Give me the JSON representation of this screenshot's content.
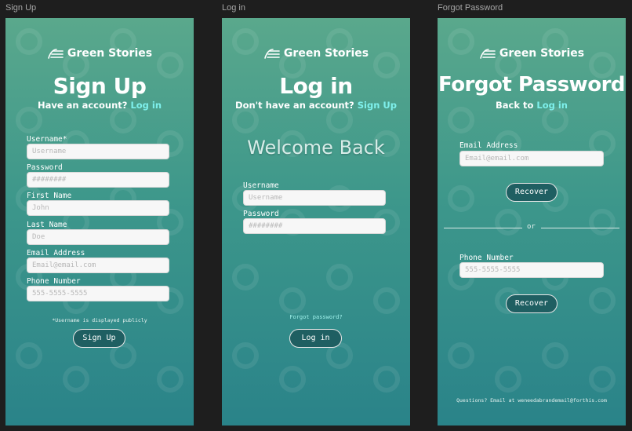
{
  "frames": {
    "signup": "Sign Up",
    "login": "Log in",
    "forgot": "Forgot Password"
  },
  "brand": {
    "name": "Green Stories"
  },
  "signup": {
    "title": "Sign Up",
    "subtitle_prefix": "Have an account?",
    "subtitle_link": "Log in",
    "fields": [
      {
        "label": "Username*",
        "placeholder": "Username"
      },
      {
        "label": "Password",
        "placeholder": "########"
      },
      {
        "label": "First Name",
        "placeholder": "John"
      },
      {
        "label": "Last Name",
        "placeholder": "Doe"
      },
      {
        "label": "Email Address",
        "placeholder": "Email@email.com"
      },
      {
        "label": "Phone Number",
        "placeholder": "555-5555-5555"
      }
    ],
    "note": "*Username is displayed publicly",
    "button": "Sign Up"
  },
  "login": {
    "title": "Log in",
    "subtitle_prefix": "Don't have an account?",
    "subtitle_link": "Sign Up",
    "welcome": "Welcome Back",
    "fields": [
      {
        "label": "Username",
        "placeholder": "Username"
      },
      {
        "label": "Password",
        "placeholder": "########"
      }
    ],
    "forgot_link": "Forgot password?",
    "button": "Log in"
  },
  "forgot": {
    "title": "Forgot Password",
    "subtitle_prefix": "Back to",
    "subtitle_link": "Log in",
    "email_label": "Email Address",
    "email_placeholder": "Email@email.com",
    "recover_button": "Recover",
    "divider": "or",
    "phone_label": "Phone Number",
    "phone_placeholder": "555-5555-5555",
    "recover_button_2": "Recover",
    "contact": "Questions? Email at weneedabrandemail@forthis.com"
  },
  "colors": {
    "accent_link": "#7ef0ec",
    "button_bg": "#1f5f62",
    "gradient_top": "#5aa88c",
    "gradient_bottom": "#2a8389"
  },
  "icons": {
    "logo": "leaf-lines-icon"
  }
}
